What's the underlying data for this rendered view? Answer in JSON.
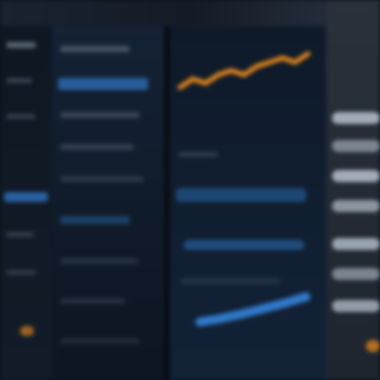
{
  "colors": {
    "background": "#0b1119",
    "accent_blue": "#2f78c7",
    "accent_orange": "#d9821c",
    "panel": "#142235",
    "highlight": "#b8c3cf"
  },
  "icons": [
    "orange-dot-icon"
  ],
  "chart": {
    "orange_line": [
      3,
      5,
      4,
      6,
      7,
      6,
      8,
      9,
      10,
      9,
      11
    ],
    "blue_line": [
      2,
      2.4,
      2.9,
      3.5,
      4.1,
      4.8
    ]
  }
}
